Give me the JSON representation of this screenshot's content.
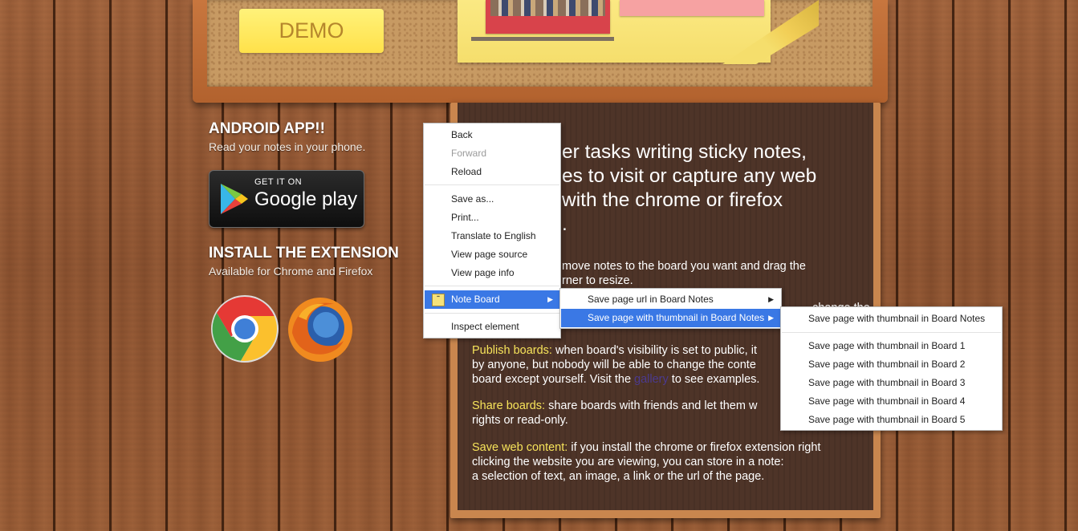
{
  "header": {
    "demo_label": "DEMO"
  },
  "left": {
    "android_title": "ANDROID APP!!",
    "android_text": "Read your notes in your phone.",
    "gplay_get": "GET IT ON",
    "gplay_name": "Google play",
    "ext_title": "INSTALL THE EXTENSION",
    "ext_text": "Available for Chrome and Firefox"
  },
  "panel": {
    "title_lines": [
      "er tasks writing sticky notes,",
      "es to visit or capture any web",
      "with the chrome or firefox",
      "."
    ],
    "p1_lines": [
      "move notes to the board you want and drag the",
      "rner to resize."
    ],
    "p2_partial": "change the",
    "publish_label": "Publish boards:",
    "publish_lines": [
      " when board's visibility is set to public, it",
      "by anyone, but nobody will be able to change the conte",
      "board except yourself. Visit the "
    ],
    "gallery_link": "gallery",
    "publish_tail": " to see examples.",
    "share_label": "Share boards:",
    "share_lines": [
      " share boards with friends and let them w",
      "rights or read-only."
    ],
    "save_label": "Save web content:",
    "save_lines": [
      " if you install the chrome or firefox extension right",
      "clicking the website you are viewing, you can store in a note:",
      "a selection of text, an image, a link or the url of the page."
    ]
  },
  "context_menu": {
    "items": [
      "Back",
      "Forward",
      "Reload",
      "Save as...",
      "Print...",
      "Translate to English",
      "View page source",
      "View page info",
      "Note Board",
      "Inspect element"
    ],
    "note_board_icon": "note-board-icon",
    "submenu": [
      "Save page url in Board Notes",
      "Save page with thumbnail in Board Notes"
    ],
    "submenu2": [
      "Save page with thumbnail in Board Notes",
      "Save page with thumbnail in Board 1",
      "Save page with thumbnail in Board 2",
      "Save page with thumbnail in Board 3",
      "Save page with thumbnail in Board 4",
      "Save page with thumbnail in Board 5"
    ]
  },
  "colors": {
    "highlight": "#f6e35a",
    "menu_active": "#3a78e5",
    "panel_bg": "#4e3428",
    "wood": "#9a5c35"
  }
}
